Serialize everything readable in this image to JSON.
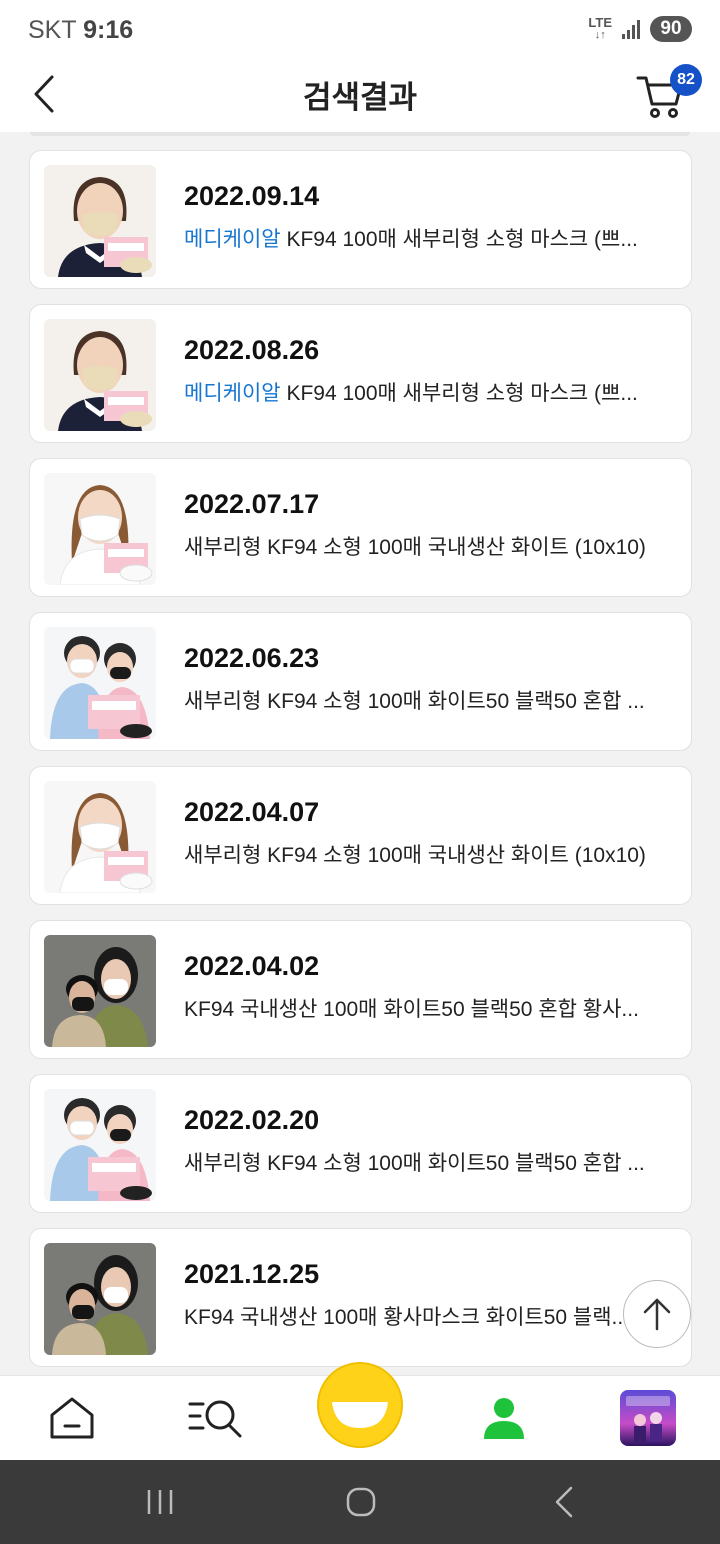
{
  "status_bar": {
    "carrier": "SKT",
    "time": "9:16",
    "network": "LTE",
    "battery": "90"
  },
  "header": {
    "title": "검색결과",
    "cart_count": "82"
  },
  "orders": [
    {
      "date": "2022.09.14",
      "brand": "메디케이알",
      "title": " KF94 100매 새부리형 소형 마스크 (쁘...",
      "thumb": "child-beige"
    },
    {
      "date": "2022.08.26",
      "brand": "메디케이알",
      "title": " KF94 100매 새부리형 소형 마스크 (쁘...",
      "thumb": "child-beige"
    },
    {
      "date": "2022.07.17",
      "brand": "",
      "title": "새부리형 KF94 소형 100매 국내생산 화이트 (10x10)",
      "thumb": "child-white"
    },
    {
      "date": "2022.06.23",
      "brand": "",
      "title": "새부리형 KF94 소형 100매 화이트50 블랙50 혼합 ...",
      "thumb": "kids-mixed"
    },
    {
      "date": "2022.04.07",
      "brand": "",
      "title": "새부리형 KF94 소형 100매 국내생산 화이트 (10x10)",
      "thumb": "child-white"
    },
    {
      "date": "2022.04.02",
      "brand": "",
      "title": "KF94 국내생산 100매 화이트50 블랙50 혼합 황사...",
      "thumb": "adults-mixed"
    },
    {
      "date": "2022.02.20",
      "brand": "",
      "title": "새부리형 KF94 소형 100매 화이트50 블랙50 혼합 ...",
      "thumb": "kids-mixed"
    },
    {
      "date": "2021.12.25",
      "brand": "",
      "title": "KF94 국내생산 100매 황사마스크 화이트50 블랙...",
      "thumb": "adults-mixed"
    }
  ],
  "colors": {
    "brand_text": "#1676d2",
    "cart_badge": "#1552c8",
    "center_button": "#ffd21a",
    "my_page_icon": "#1fc33b"
  },
  "bottom_nav": {
    "items": [
      "home-icon",
      "search-list-icon",
      "center-smile-button",
      "my-page-icon",
      "game-thumbnail"
    ]
  }
}
